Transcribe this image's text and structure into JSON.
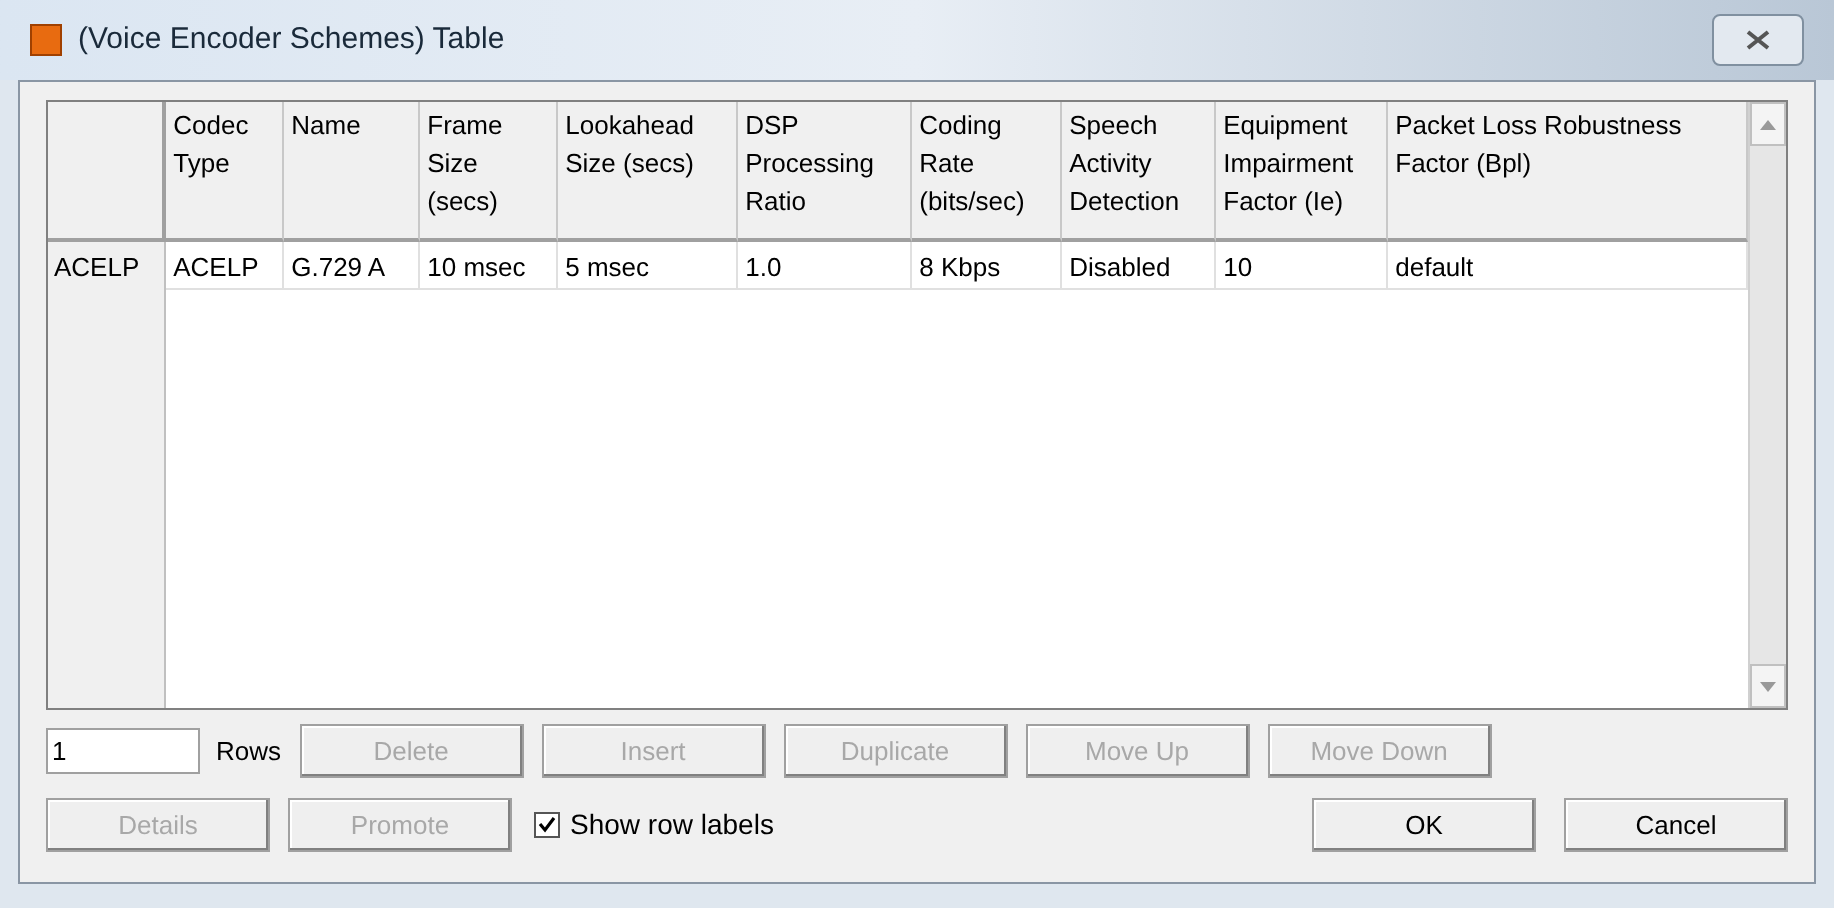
{
  "window": {
    "title": "(Voice Encoder Schemes) Table"
  },
  "table": {
    "columns": [
      "Codec Type",
      "Name",
      "Frame Size (secs)",
      "Lookahead Size (secs)",
      "DSP Processing Ratio",
      "Coding Rate (bits/sec)",
      "Speech Activity Detection",
      "Equipment Impairment Factor (Ie)",
      "Packet Loss Robustness Factor (Bpl)"
    ],
    "rows": [
      {
        "label": "ACELP",
        "cells": [
          "ACELP",
          "G.729 A",
          "10 msec",
          "5 msec",
          "1.0",
          "8 Kbps",
          "Disabled",
          "10",
          "default"
        ]
      }
    ]
  },
  "rows_field": {
    "value": "1",
    "label": "Rows"
  },
  "row_buttons": [
    {
      "label": "Delete",
      "disabled": true
    },
    {
      "label": "Insert",
      "disabled": true
    },
    {
      "label": "Duplicate",
      "disabled": true
    },
    {
      "label": "Move Up",
      "disabled": true
    },
    {
      "label": "Move Down",
      "disabled": true
    }
  ],
  "bottom_buttons": [
    {
      "label": "Details",
      "disabled": true
    },
    {
      "label": "Promote",
      "disabled": true
    }
  ],
  "show_row_labels": {
    "label": "Show row labels",
    "checked": true
  },
  "dialog_buttons": [
    {
      "label": "OK",
      "disabled": false
    },
    {
      "label": "Cancel",
      "disabled": false
    }
  ]
}
